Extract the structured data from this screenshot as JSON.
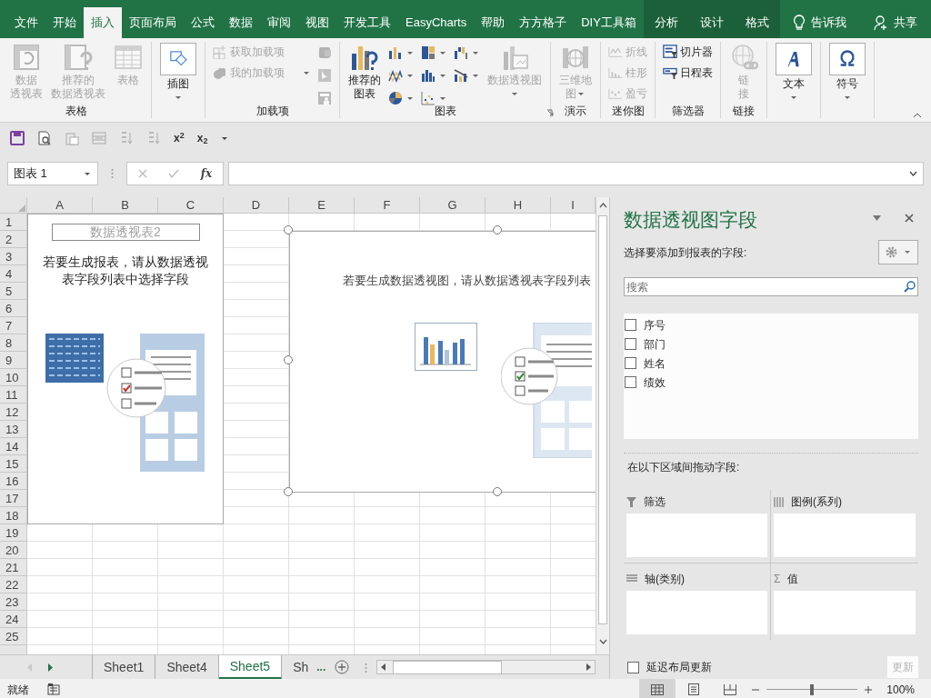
{
  "ribbon_tabs": [
    {
      "label": "文件",
      "selected": false,
      "contextual": false
    },
    {
      "label": "开始",
      "selected": false,
      "contextual": false
    },
    {
      "label": "插入",
      "selected": true,
      "contextual": false
    },
    {
      "label": "页面布局",
      "selected": false,
      "contextual": false
    },
    {
      "label": "公式",
      "selected": false,
      "contextual": false
    },
    {
      "label": "数据",
      "selected": false,
      "contextual": false
    },
    {
      "label": "审阅",
      "selected": false,
      "contextual": false
    },
    {
      "label": "视图",
      "selected": false,
      "contextual": false
    },
    {
      "label": "开发工具",
      "selected": false,
      "contextual": false
    },
    {
      "label": "EasyCharts",
      "selected": false,
      "contextual": false
    },
    {
      "label": "帮助",
      "selected": false,
      "contextual": false
    },
    {
      "label": "方方格子",
      "selected": false,
      "contextual": false
    },
    {
      "label": "DIY工具箱",
      "selected": false,
      "contextual": false
    },
    {
      "label": "分析",
      "selected": false,
      "contextual": true
    },
    {
      "label": "设计",
      "selected": false,
      "contextual": true
    },
    {
      "label": "格式",
      "selected": false,
      "contextual": true
    }
  ],
  "tell_me": "告诉我",
  "share": "共享",
  "ribbon_groups": [
    {
      "label": "表格",
      "columns": [
        [
          {
            "kind": "large",
            "lines": [
              "数据",
              "透视表"
            ],
            "disabled": true
          }
        ],
        [
          {
            "kind": "large",
            "lines": [
              "推荐的",
              "数据透视表"
            ],
            "disabled": true
          }
        ],
        [
          {
            "kind": "large",
            "lines": [
              "表格"
            ],
            "disabled": true
          }
        ]
      ]
    },
    {
      "columns": [
        [
          {
            "kind": "large",
            "lines": [
              "插图"
            ],
            "disabled": false,
            "boxed": true,
            "dropdown": true
          }
        ]
      ]
    },
    {
      "label": "加载项",
      "columns": [
        [
          {
            "kind": "small",
            "label": "获取加载项",
            "disabled": true
          },
          {
            "kind": "small",
            "label": "我的加载项",
            "disabled": true,
            "dropdown": true
          }
        ],
        [
          {
            "kind": "icon",
            "disabled": true
          },
          {
            "kind": "icon",
            "disabled": true
          },
          {
            "kind": "icon",
            "disabled": true
          }
        ]
      ]
    },
    {
      "label": "图表",
      "launcher": true,
      "columns": [
        [
          {
            "kind": "large",
            "lines": [
              "推荐的",
              "图表"
            ],
            "disabled": false
          }
        ],
        [
          {
            "kind": "icon",
            "disabled": false,
            "dropdown": true
          },
          {
            "kind": "icon",
            "disabled": false,
            "dropdown": true
          },
          {
            "kind": "icon",
            "disabled": false,
            "dropdown": true
          }
        ],
        [
          {
            "kind": "icon",
            "disabled": false,
            "dropdown": true
          },
          {
            "kind": "icon",
            "disabled": false,
            "dropdown": true
          },
          {
            "kind": "icon",
            "disabled": false,
            "dropdown": true
          }
        ],
        [
          {
            "kind": "icon",
            "disabled": false,
            "dropdown": true
          },
          {
            "kind": "icon",
            "disabled": false,
            "dropdown": true
          }
        ],
        [
          {
            "kind": "large",
            "lines": [
              "数据透视图"
            ],
            "disabled": true,
            "dropdown": true
          }
        ]
      ]
    },
    {
      "label": "演示",
      "columns": [
        [
          {
            "kind": "large",
            "lines": [
              "三维地",
              "图"
            ],
            "disabled": true,
            "dropdown": true
          }
        ]
      ]
    },
    {
      "label": "迷你图",
      "columns": [
        [
          {
            "kind": "small",
            "label": "折线",
            "disabled": true
          },
          {
            "kind": "small",
            "label": "柱形",
            "disabled": true
          },
          {
            "kind": "small",
            "label": "盈亏",
            "disabled": true
          }
        ]
      ]
    },
    {
      "label": "筛选器",
      "columns": [
        [
          {
            "kind": "small",
            "label": "切片器",
            "disabled": false
          },
          {
            "kind": "small",
            "label": "日程表",
            "disabled": false
          }
        ]
      ]
    },
    {
      "label": "链接",
      "columns": [
        [
          {
            "kind": "large",
            "lines": [
              "链",
              "接"
            ],
            "disabled": true
          }
        ]
      ]
    },
    {
      "columns": [
        [
          {
            "kind": "large",
            "lines": [
              "文本"
            ],
            "disabled": false,
            "boxed": true,
            "dropdown": true
          }
        ]
      ]
    },
    {
      "columns": [
        [
          {
            "kind": "large",
            "lines": [
              "符号"
            ],
            "disabled": false,
            "boxed": true,
            "dropdown": true
          }
        ]
      ]
    }
  ],
  "quick_access": [
    {
      "kind": "save"
    },
    {
      "kind": "preview"
    },
    {
      "kind": "paste"
    },
    {
      "kind": "form"
    },
    {
      "kind": "sortdesc"
    },
    {
      "kind": "sortasc"
    },
    {
      "kind": "text",
      "label": "x$^{2}$"
    },
    {
      "kind": "text",
      "label": "x$_{2}$"
    },
    {
      "kind": "customize"
    }
  ],
  "formula_bar": {
    "name_box": "图表 1",
    "buttons": [
      {
        "kind": "cancel",
        "disabled": true
      },
      {
        "kind": "enter",
        "disabled": true
      },
      {
        "kind": "function",
        "label": "fx",
        "disabled": false
      }
    ]
  },
  "sheet": {
    "columns": [
      "A",
      "B",
      "C",
      "D",
      "E",
      "F",
      "G",
      "H",
      "I"
    ],
    "rows": [
      "1",
      "2",
      "3",
      "4",
      "5",
      "6",
      "7",
      "8",
      "9",
      "10",
      "11",
      "12",
      "13",
      "14",
      "15",
      "16",
      "17",
      "18",
      "19",
      "20",
      "21",
      "22",
      "23",
      "24",
      "25"
    ],
    "pivot_placeholder": {
      "name": "数据透视表2",
      "message_lines": [
        "若要生成报表，请从数据透视",
        "表字段列表中选择字段"
      ]
    },
    "chart": {
      "selected": true,
      "message": "若要生成数据透视图，请从数据透视表字段列表"
    }
  },
  "sheet_tabs": {
    "prev_disabled": true,
    "tabs": [
      {
        "label": "Sheet1",
        "selected": false
      },
      {
        "label": "Sheet4",
        "selected": false
      },
      {
        "label": "Sheet5",
        "selected": true
      },
      {
        "label": "Sh",
        "selected": false
      }
    ],
    "more": "..."
  },
  "status_bar": {
    "ready": "就绪",
    "views": [
      {
        "kind": "normal",
        "selected": true
      },
      {
        "kind": "layout",
        "selected": false
      },
      {
        "kind": "pagebreak",
        "selected": false
      }
    ],
    "zoom": {
      "level": 0.5,
      "reading": "100%"
    }
  },
  "field_panel": {
    "title": "数据透视图字段",
    "prompt": "选择要添加到报表的字段:",
    "search": {
      "placeholder": "搜索"
    },
    "fields": [
      {
        "label": "序号",
        "checked": false
      },
      {
        "label": "部门",
        "checked": false
      },
      {
        "label": "姓名",
        "checked": false
      },
      {
        "label": "绩效",
        "checked": false
      }
    ],
    "drag_prompt": "在以下区域间拖动字段:",
    "areas": [
      {
        "kind": "filter",
        "label": "筛选"
      },
      {
        "kind": "legend",
        "label": "图例(系列)"
      },
      {
        "kind": "axis",
        "label": "轴(类别)"
      },
      {
        "kind": "values",
        "label": "值",
        "symbol": "Σ"
      }
    ],
    "defer": {
      "label": "延迟布局更新",
      "checked": false
    },
    "update_button": {
      "label": "更新",
      "disabled": true
    }
  }
}
